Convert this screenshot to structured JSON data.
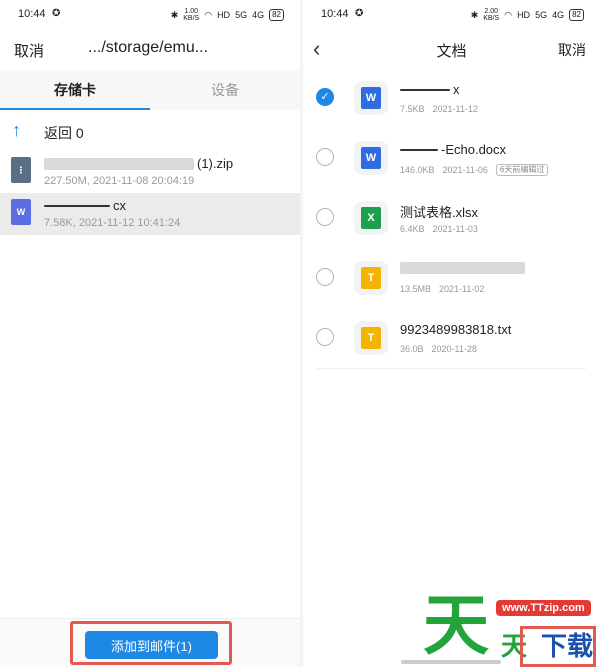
{
  "status": {
    "time": "10:44",
    "left_speed": "1.00",
    "right_speed": "2.00",
    "speed_unit": "KB/S",
    "battery": "82",
    "signal1": "5G",
    "signal2": "4G",
    "hd": "HD"
  },
  "left": {
    "cancel": "取消",
    "path": ".../storage/emu...",
    "tabs": {
      "storage": "存储卡",
      "device": "设备"
    },
    "return_label": "返回 0",
    "files": [
      {
        "name_suffix": "(1).zip",
        "meta": "227.50M, 2021-11-08 20:04:19",
        "icon": "zip"
      },
      {
        "name_suffix": "cx",
        "meta": "7.58K, 2021-11-12 10:41:24",
        "icon": "W"
      }
    ],
    "add_button": "添加到邮件(1)"
  },
  "right": {
    "title": "文档",
    "cancel": "取消",
    "docs": [
      {
        "name_suffix": "x",
        "size": "7.5KB",
        "date": "2021-11-12",
        "icon": "W",
        "checked": true
      },
      {
        "name_suffix": "-Echo.docx",
        "size": "146.0KB",
        "date": "2021-11-06",
        "tag": "6天前编辑过",
        "icon": "W",
        "checked": false
      },
      {
        "name": "测试表格.xlsx",
        "size": "6.4KB",
        "date": "2021-11-03",
        "icon": "X",
        "checked": false
      },
      {
        "name_suffix": "",
        "size": "13.5MB",
        "date": "2021-11-02",
        "icon": "T",
        "checked": false
      },
      {
        "name": "9923489983818.txt",
        "size": "36.0B",
        "date": "2020-11-28",
        "icon": "T",
        "checked": false
      }
    ]
  },
  "watermark": {
    "big_char": "天",
    "badge": "www.TTzip.com",
    "small1": "天",
    "small2": "下载"
  },
  "colors": {
    "accent": "#1e88e5",
    "highlight_frame": "#e05a4f",
    "word": "#2e6cdf",
    "excel": "#1e9e4f",
    "text_file": "#f5b400"
  }
}
